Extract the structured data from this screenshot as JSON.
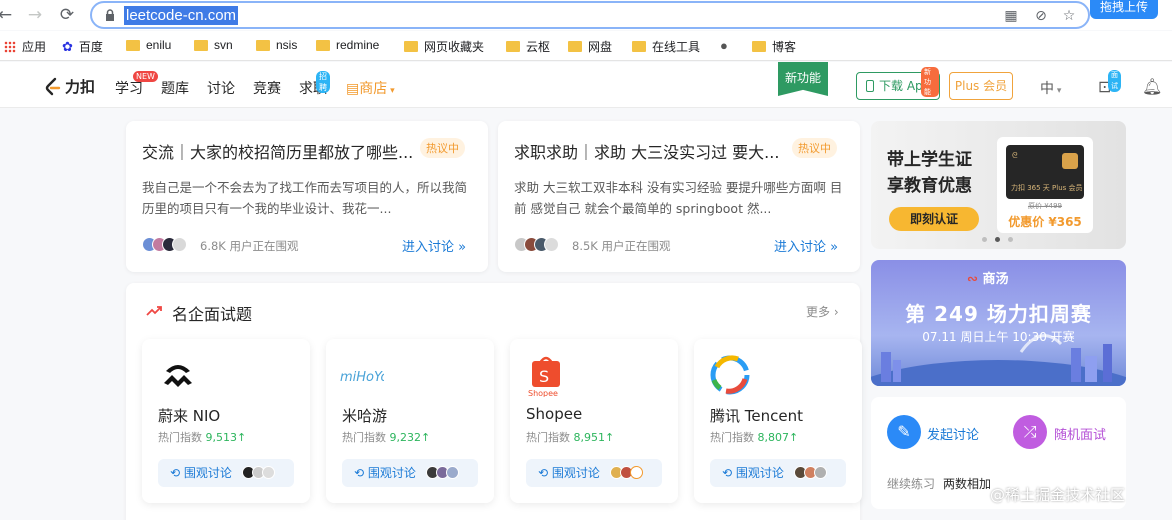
{
  "browser": {
    "url": "leetcode-cn.com",
    "upload_badge": "拖拽上传",
    "bookmarks": [
      {
        "label": "应用",
        "icon": "apps-icon"
      },
      {
        "label": "百度",
        "icon": "baidu-icon"
      },
      {
        "label": "enilu",
        "icon": "folder-icon"
      },
      {
        "label": "svn",
        "icon": "folder-icon"
      },
      {
        "label": "nsis",
        "icon": "folder-icon"
      },
      {
        "label": "redmine",
        "icon": "folder-icon"
      },
      {
        "label": "网页收藏夹",
        "icon": "folder-icon"
      },
      {
        "label": "云枢",
        "icon": "folder-icon"
      },
      {
        "label": "网盘",
        "icon": "folder-icon"
      },
      {
        "label": "在线工具",
        "icon": "folder-icon"
      },
      {
        "label": "",
        "icon": "globe-icon"
      },
      {
        "label": "博客",
        "icon": "folder-icon"
      }
    ]
  },
  "header": {
    "logo_text": "力扣",
    "nav": [
      {
        "label": "学习",
        "badge": "NEW"
      },
      {
        "label": "题库",
        "badge": ""
      },
      {
        "label": "讨论",
        "badge": ""
      },
      {
        "label": "竞赛",
        "badge": ""
      },
      {
        "label": "求职",
        "badge": "招聘"
      },
      {
        "label": "商店",
        "badge": ""
      }
    ],
    "new_feature": "新功能",
    "download_app": "下载 App",
    "download_badge": "新功能",
    "plus": "Plus 会员",
    "lang": "中",
    "interview_badge": "面试"
  },
  "discussions": [
    {
      "title": "交流｜大家的校招简历里都放了哪些...",
      "tag": "热议中",
      "body": "我自己是一个不会去为了找工作而去写项目的人，所以我简历里的项目只有一个我的毕业设计、我花一...",
      "viewers": "6.8K 用户正在围观",
      "enter": "进入讨论 »"
    },
    {
      "title": "求职求助｜求助  大三没实习过  要大...",
      "tag": "热议中",
      "body": "求助 大三软工双非本科 没有实习经验 要提升哪些方面啊 目前 感觉自己 就会个最简单的 springboot 然...",
      "viewers": "8.5K 用户正在围观",
      "enter": "进入讨论 »"
    }
  ],
  "companies_section": {
    "title": "名企面试题",
    "more": "更多 ›",
    "hot_label": "热门指数",
    "btn_label": "围观讨论",
    "companies": [
      {
        "name": "蔚来 NIO",
        "hot": "9,513↑",
        "logo": "nio-logo-icon"
      },
      {
        "name": "米哈游",
        "hot": "9,232↑",
        "logo": "mihoyo-logo-icon"
      },
      {
        "name": "Shopee",
        "hot": "8,951↑",
        "logo": "shopee-logo-icon"
      },
      {
        "name": "腾讯 Tencent",
        "hot": "8,807↑",
        "logo": "tencent-logo-icon"
      }
    ]
  },
  "promo": {
    "line1": "带上学生证",
    "line2": "享教育优惠",
    "button": "即刻认证",
    "card_text": "力扣 365 天 Plus 会员",
    "old_price": "原价 ¥499",
    "price": "优惠价 ¥365"
  },
  "contest": {
    "sponsor": "商汤",
    "title": "第 249 场力扣周赛",
    "time": "07.11 周日上午 10:30 开赛"
  },
  "actions": {
    "start_discussion": "发起讨论",
    "random_interview": "随机面试",
    "continue_label": "继续练习",
    "continue_problem": "两数相加"
  },
  "watermark": "@稀土掘金技术社区",
  "colors": {
    "brand_green": "#2e9a62",
    "link_blue": "#1b7ad6",
    "hot_orange": "#f29a2e"
  }
}
